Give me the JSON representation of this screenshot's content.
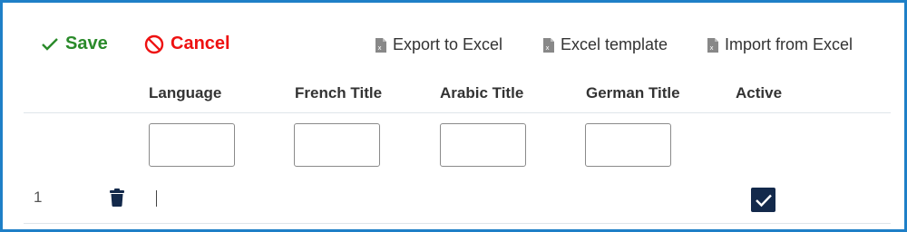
{
  "toolbar": {
    "save_label": "Save",
    "cancel_label": "Cancel",
    "export_label": "Export to Excel",
    "template_label": "Excel template",
    "import_label": "Import from Excel"
  },
  "icons": {
    "save": "checkmark-icon",
    "cancel": "prohibited-icon",
    "excel": "excel-file-icon",
    "delete": "trash-icon",
    "checkbox": "checkmark-icon"
  },
  "colors": {
    "save": "#2a8a2a",
    "cancel": "#ee1111",
    "frame_border": "#1e7fc7",
    "checkbox_fill": "#13294b",
    "trash": "#13294b"
  },
  "columns": [
    "Language",
    "French Title",
    "Arabic Title",
    "German Title",
    "Active"
  ],
  "filters": {
    "language": "",
    "french_title": "",
    "arabic_title": "",
    "german_title": ""
  },
  "rows": [
    {
      "number": "1",
      "language": "",
      "active": true
    }
  ]
}
